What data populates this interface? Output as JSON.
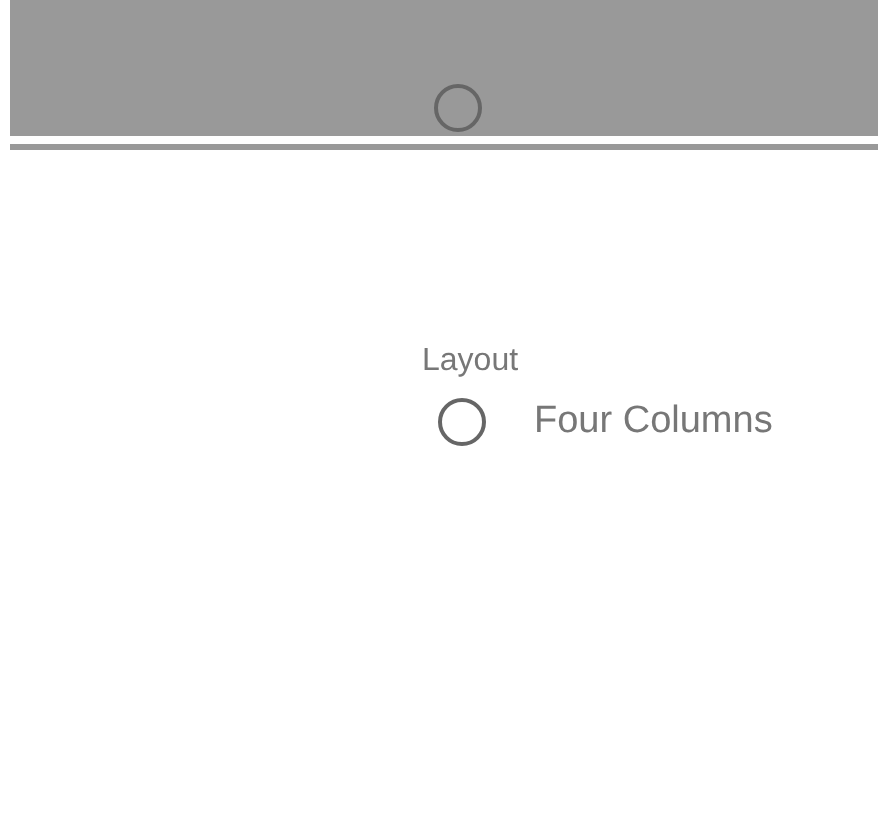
{
  "header": {
    "radio": {
      "selected": false
    }
  },
  "layout": {
    "label": "Layout",
    "options": [
      {
        "label": "Four Columns",
        "selected": false
      }
    ]
  }
}
